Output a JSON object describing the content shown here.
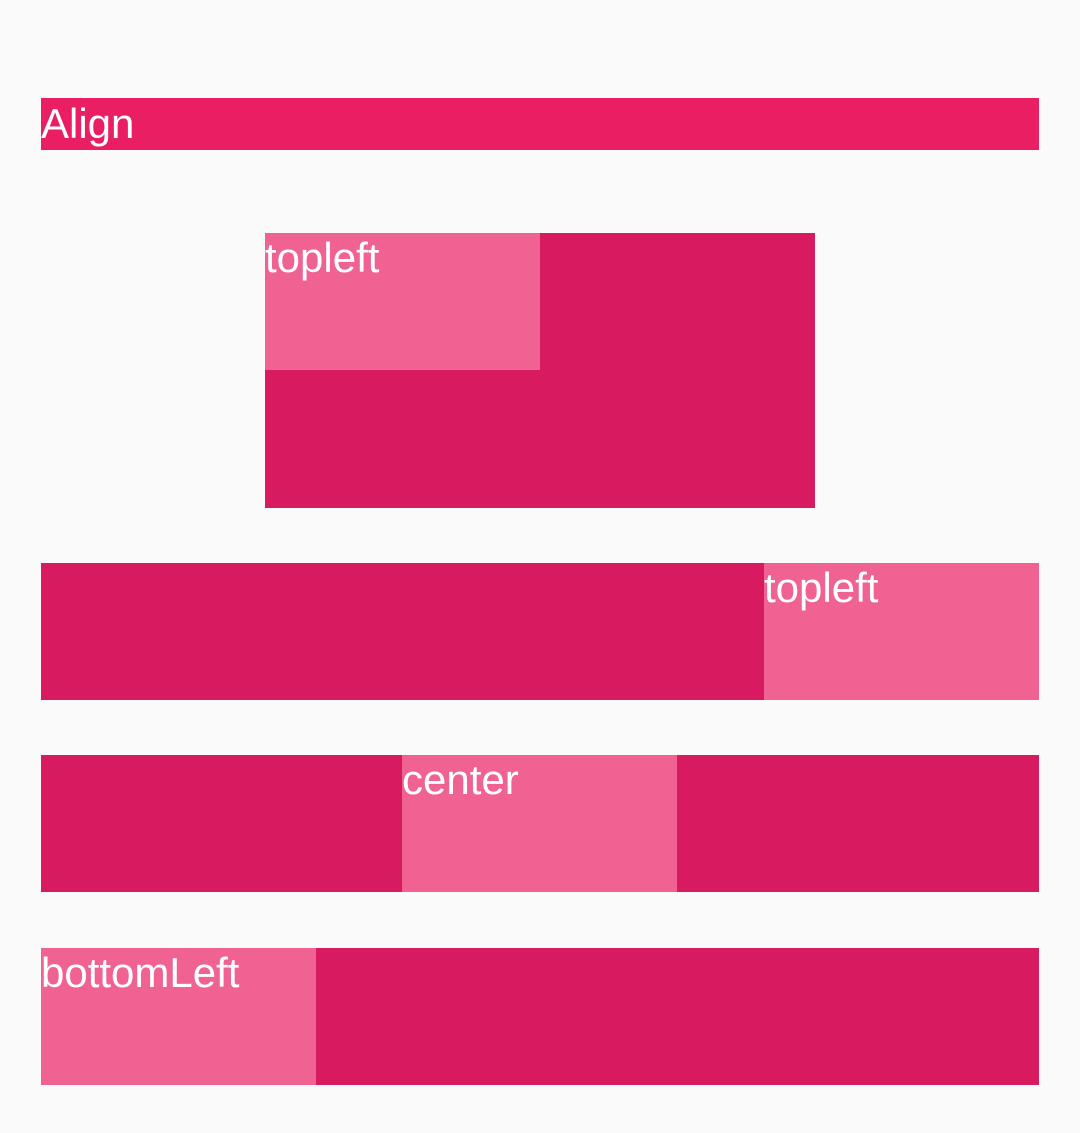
{
  "header": {
    "title": "Align"
  },
  "demos": [
    {
      "label": "topleft"
    },
    {
      "label": "topleft"
    },
    {
      "label": "center"
    },
    {
      "label": "bottomLeft"
    }
  ],
  "colors": {
    "background": "#fafafa",
    "header": "#e91e63",
    "outer_box": "#d81b60",
    "inner_box": "#f06292",
    "text": "#ffffff"
  }
}
